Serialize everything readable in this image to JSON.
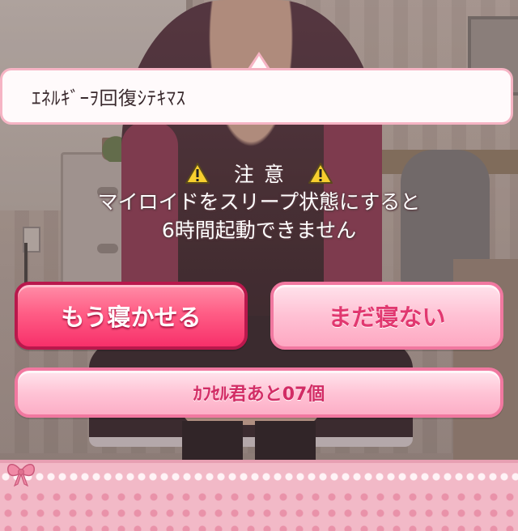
{
  "bubble": {
    "text": "ｴﾈﾙｷﾞｰｦ回復ｼﾃｷﾏｽ"
  },
  "warning": {
    "title": "注意",
    "line1": "マイロイドをスリープ状態にすると",
    "line2": "6時間起動できません"
  },
  "buttons": {
    "sleep_label": "もう寝かせる",
    "not_yet_label": "まだ寝ない",
    "capsule_label": "ｶﾌｾﾙ君あと07個"
  },
  "colors": {
    "primary_button": "#f7306a",
    "secondary_button": "#fdb4c9",
    "secondary_text": "#e13870",
    "bubble_border": "#f6b4c4"
  },
  "icons": [
    "warning-icon",
    "warning-icon",
    "bow-icon"
  ]
}
